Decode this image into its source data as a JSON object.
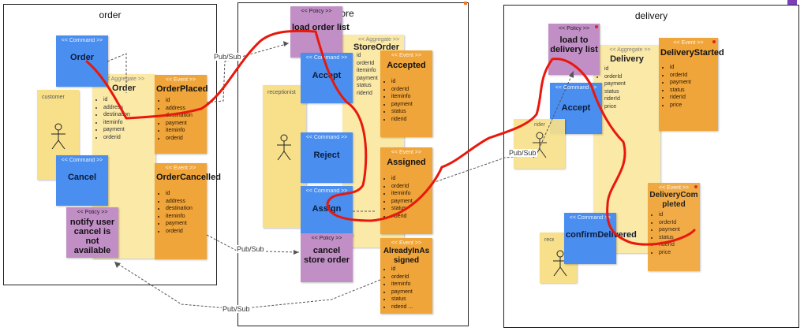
{
  "contexts": [
    {
      "key": "order",
      "title": "order"
    },
    {
      "key": "store",
      "title": "store"
    },
    {
      "key": "delivery",
      "title": "delivery"
    }
  ],
  "stereotypes": {
    "command": "<< Command >>",
    "event": "<< Event >>",
    "policy": "<< Policy >>",
    "aggregate": "<< Aggregate >>"
  },
  "order": {
    "actor": "customer",
    "cmd_order": "Order",
    "cmd_cancel": "Cancel",
    "agg": {
      "name": "Order",
      "fields": [
        "id",
        "address",
        "destination",
        "iteminfo",
        "payment",
        "orderid"
      ]
    },
    "evt_placed": {
      "name": "OrderPlaced",
      "fields": [
        "id",
        "address",
        "destination",
        "payment",
        "iteminfo",
        "orderid"
      ]
    },
    "evt_cancelled": {
      "name": "OrderCancelled",
      "fields": [
        "id",
        "address",
        "destination",
        "iteminfo",
        "payment",
        "orderid"
      ]
    },
    "pol_notify": "notify user cancel is not available"
  },
  "store": {
    "actor": "receptionist",
    "pol_load": "load order list",
    "cmd_accept": "Accept",
    "cmd_reject": "Reject",
    "cmd_assign": "Assign",
    "agg": {
      "name": "StoreOrder",
      "fields": [
        "id",
        "orderId",
        "iteminfo",
        "payment",
        "status",
        "riderId"
      ]
    },
    "evt_accepted": {
      "name": "Accepted",
      "fields": [
        "id",
        "orderId",
        "iteminfo",
        "payment",
        "status",
        "riderid"
      ]
    },
    "evt_assigned": {
      "name": "Assigned",
      "fields": [
        "id",
        "orderId",
        "iteminfo",
        "payment",
        "status",
        "riderid"
      ]
    },
    "pol_cancel": "cancel store order",
    "evt_already": {
      "name": "AlreadyInAssigned",
      "fields": [
        "id",
        "orderId",
        "iteminfo",
        "payment",
        "status",
        "riderid ..."
      ]
    }
  },
  "delivery": {
    "actor_rider": "rider",
    "actor_rec": "receptionist",
    "pol_load": "load to delivery list",
    "agg": {
      "name": "Delivery",
      "fields": [
        "id",
        "orderId",
        "payment",
        "status",
        "riderId",
        "price"
      ]
    },
    "cmd_accept": "Accept",
    "cmd_confirm": "confirmDelivered",
    "evt_started": {
      "name": "DeliveryStarted",
      "fields": [
        "id",
        "orderId",
        "payment",
        "status",
        "riderId",
        "price"
      ]
    },
    "evt_completed": {
      "name": "DeliveryCompleted",
      "fields": [
        "id",
        "orderId",
        "payment",
        "status",
        "riderId",
        "price"
      ]
    }
  },
  "edges": {
    "pubsub": "Pub/Sub"
  },
  "colors": {
    "command": "#4a8ef0",
    "event": "#f0a53a",
    "policy": "#c18fc6",
    "aggregate": "#fbe9a8",
    "actor": "#f8e08a",
    "annotation": "#e8180c"
  }
}
